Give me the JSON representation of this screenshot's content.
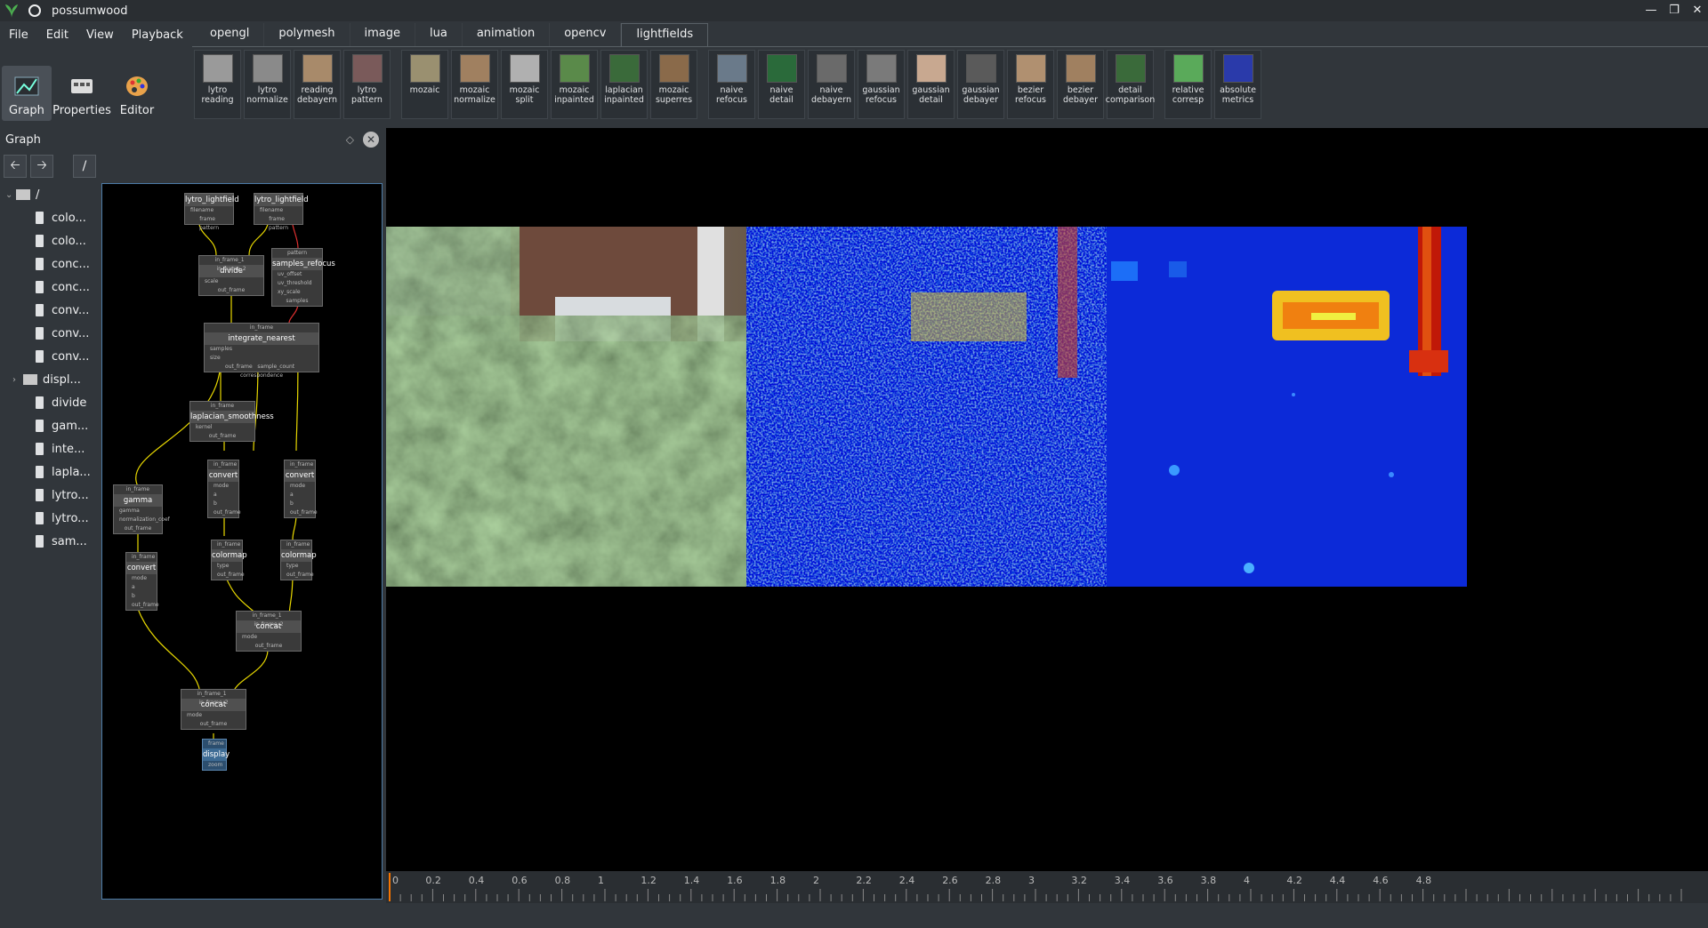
{
  "window": {
    "title": "possumwood"
  },
  "menu": [
    "File",
    "Edit",
    "View",
    "Playback"
  ],
  "tabs": [
    "opengl",
    "polymesh",
    "image",
    "lua",
    "animation",
    "opencv",
    "lightfields"
  ],
  "active_tab": "lightfields",
  "left_toolbar": [
    "Graph",
    "Properties",
    "Editor"
  ],
  "shelf_groups": [
    [
      {
        "label": "lytro reading",
        "thumb": "#9a9a9a"
      },
      {
        "label": "lytro normalize",
        "thumb": "#8a8a8a"
      },
      {
        "label": "reading debayern",
        "thumb": "#a88a6a"
      },
      {
        "label": "lytro pattern",
        "thumb": "#7a5a5a"
      }
    ],
    [
      {
        "label": "mozaic",
        "thumb": "#9a9070"
      },
      {
        "label": "mozaic normalize",
        "thumb": "#a08060"
      },
      {
        "label": "mozaic split",
        "thumb": "#b0b0b0"
      },
      {
        "label": "mozaic inpainted",
        "thumb": "#5a8a4a"
      },
      {
        "label": "laplacian inpainted",
        "thumb": "#3a6a3a"
      },
      {
        "label": "mozaic superres",
        "thumb": "#8a6a4a"
      }
    ],
    [
      {
        "label": "naive refocus",
        "thumb": "#6a7a8a"
      },
      {
        "label": "naive detail",
        "thumb": "#2a6a3a"
      },
      {
        "label": "naive debayern",
        "thumb": "#6a6a6a"
      },
      {
        "label": "gaussian refocus",
        "thumb": "#7a7a7a"
      },
      {
        "label": "gaussian detail",
        "thumb": "#c8a890"
      },
      {
        "label": "gaussian debayer",
        "thumb": "#5a5a5a"
      },
      {
        "label": "bezier refocus",
        "thumb": "#b09070"
      },
      {
        "label": "bezier debayer",
        "thumb": "#a08060"
      },
      {
        "label": "detail comparison",
        "thumb": "#3a6a3a"
      }
    ],
    [
      {
        "label": "relative corresp",
        "thumb": "#5aaa5a"
      },
      {
        "label": "absolute metrics",
        "thumb": "#2a3aaa"
      }
    ]
  ],
  "graph_panel": {
    "title": "Graph",
    "path_button": "/"
  },
  "tree": {
    "root": "/",
    "items": [
      "colo...",
      "colo...",
      "conc...",
      "conc...",
      "conv...",
      "conv...",
      "conv...",
      "displ...",
      "divide",
      "gam...",
      "inte...",
      "lapla...",
      "lytro...",
      "lytro...",
      "sam..."
    ]
  },
  "nodes": [
    {
      "id": "lf1",
      "title": "lytro_lightfield",
      "ports_in": [
        "filename"
      ],
      "ports_out": [
        "frame",
        "pattern"
      ]
    },
    {
      "id": "lf2",
      "title": "lytro_lightfield",
      "ports_in": [
        "filename"
      ],
      "ports_out": [
        "frame",
        "pattern"
      ]
    },
    {
      "id": "divide",
      "title": "divide",
      "ports_in": [
        "in_frame_1",
        "in_frame_2",
        "scale"
      ],
      "ports_out": [
        "out_frame"
      ]
    },
    {
      "id": "samples",
      "title": "samples_refocus",
      "ports_in": [
        "pattern",
        "uv_offset",
        "uv_threshold",
        "xy_scale"
      ],
      "ports_out": [
        "samples"
      ]
    },
    {
      "id": "integrate",
      "title": "integrate_nearest",
      "ports_in": [
        "in_frame",
        "samples",
        "size"
      ],
      "ports_out": [
        "out_frame",
        "sample_count",
        "correspondence"
      ]
    },
    {
      "id": "laplacian",
      "title": "laplacian_smoothness",
      "ports_in": [
        "in_frame",
        "kernel"
      ],
      "ports_out": [
        "out_frame"
      ]
    },
    {
      "id": "convert1",
      "title": "convert",
      "ports_in": [
        "in_frame",
        "mode",
        "a",
        "b"
      ],
      "ports_out": [
        "out_frame"
      ]
    },
    {
      "id": "convert2",
      "title": "convert",
      "ports_in": [
        "in_frame",
        "mode",
        "a",
        "b"
      ],
      "ports_out": [
        "out_frame"
      ]
    },
    {
      "id": "gamma",
      "title": "gamma",
      "ports_in": [
        "in_frame",
        "gamma",
        "normalization_coef"
      ],
      "ports_out": [
        "out_frame"
      ]
    },
    {
      "id": "colormap1",
      "title": "colormap",
      "ports_in": [
        "in_frame",
        "type"
      ],
      "ports_out": [
        "out_frame"
      ]
    },
    {
      "id": "colormap2",
      "title": "colormap",
      "ports_in": [
        "in_frame",
        "type"
      ],
      "ports_out": [
        "out_frame"
      ]
    },
    {
      "id": "convert3",
      "title": "convert",
      "ports_in": [
        "in_frame",
        "mode",
        "a",
        "b"
      ],
      "ports_out": [
        "out_frame"
      ]
    },
    {
      "id": "concat1",
      "title": "concat",
      "ports_in": [
        "in_frame_1",
        "in_frame_2",
        "mode"
      ],
      "ports_out": [
        "out_frame"
      ]
    },
    {
      "id": "concat2",
      "title": "concat",
      "ports_in": [
        "in_frame_1",
        "in_frame_2",
        "mode"
      ],
      "ports_out": [
        "out_frame"
      ]
    },
    {
      "id": "display",
      "title": "display",
      "ports_in": [
        "frame",
        "zoom"
      ],
      "ports_out": []
    }
  ],
  "timeline": {
    "ticks": [
      "0",
      "0.2",
      "0.4",
      "0.6",
      "0.8",
      "1",
      "1.2",
      "1.4",
      "1.6",
      "1.8",
      "2",
      "2.2",
      "2.4",
      "2.6",
      "2.8",
      "3",
      "3.2",
      "3.4",
      "3.6",
      "3.8",
      "4",
      "4.2",
      "4.4",
      "4.6",
      "4.8"
    ],
    "current": 0
  },
  "colors": {
    "bg": "#31363b",
    "accent": "#3daee9",
    "marker": "#f67400"
  },
  "icons": {
    "app": "leaf-icon",
    "pin": "pin-icon",
    "minimize": "minimize-icon",
    "maximize": "maximize-icon",
    "close": "close-icon"
  }
}
